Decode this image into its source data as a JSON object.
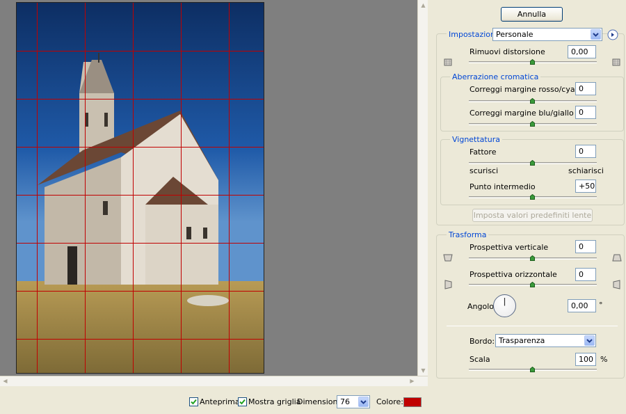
{
  "window": {
    "accent": "#0046d5",
    "grid_color": "#c00000"
  },
  "buttons": {
    "cancel": "Annulla",
    "reset_defaults": "Imposta valori predefiniti lente"
  },
  "settings": {
    "label": "Impostazioni:",
    "value": "Personale"
  },
  "remove_distortion": {
    "label": "Rimuovi distorsione",
    "value": "0,00"
  },
  "chromatic": {
    "title": "Aberrazione cromatica",
    "red_cyan": {
      "label": "Correggi margine rosso/cyan",
      "value": "0"
    },
    "blue_yellow": {
      "label": "Correggi margine blu/giallo",
      "value": "0"
    }
  },
  "vignette": {
    "title": "Vignettatura",
    "amount": {
      "label": "Fattore",
      "value": "0"
    },
    "darken": "scurisci",
    "lighten": "schiarisci",
    "midpoint": {
      "label": "Punto intermedio",
      "value": "+50"
    }
  },
  "transform": {
    "title": "Trasforma",
    "vertical": {
      "label": "Prospettiva verticale",
      "value": "0"
    },
    "horizontal": {
      "label": "Prospettiva orizzontale",
      "value": "0"
    },
    "angle": {
      "label": "Angolo:",
      "value": "0,00",
      "unit": "°"
    },
    "edge": {
      "label": "Bordo:",
      "value": "Trasparenza"
    },
    "scale": {
      "label": "Scala",
      "value": "100",
      "unit": "%"
    }
  },
  "footer": {
    "preview": "Anteprima",
    "show_grid": "Mostra griglia",
    "size_label": "Dimensione:",
    "size_value": "76",
    "color_label": "Colore:"
  }
}
